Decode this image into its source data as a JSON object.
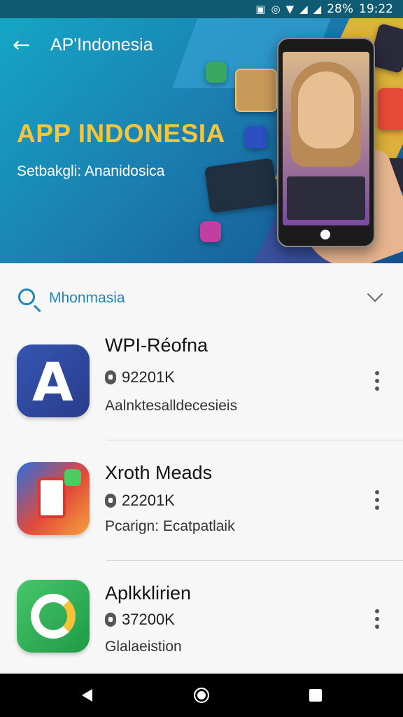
{
  "status": {
    "battery": "28%",
    "time": "19:22"
  },
  "header": {
    "title": "AP'Indonesia"
  },
  "banner": {
    "headline": "APP INDONESIA",
    "subline": "Setbakgli: Ananidosica"
  },
  "search": {
    "text": "Mhonmasia"
  },
  "apps": [
    {
      "name": "WPI-Réofna",
      "count": "92201K",
      "desc": "Aalnktesalldecesieis",
      "icon": "letter-a-app-icon",
      "color": "#2f4fa0"
    },
    {
      "name": "Xroth Meads",
      "count": "22201K",
      "desc": "Pcarign: Ecatpatlaik",
      "icon": "phone-doc-app-icon",
      "color": "#e24a3a"
    },
    {
      "name": "Aplkklirien",
      "count": "37200K",
      "desc": "Glalaeistion",
      "icon": "refresh-g-app-icon",
      "color": "#2fae52"
    }
  ],
  "colors": {
    "accent": "#1e86b8",
    "headline": "#f5c63b",
    "statusbar": "#0f5b73"
  }
}
